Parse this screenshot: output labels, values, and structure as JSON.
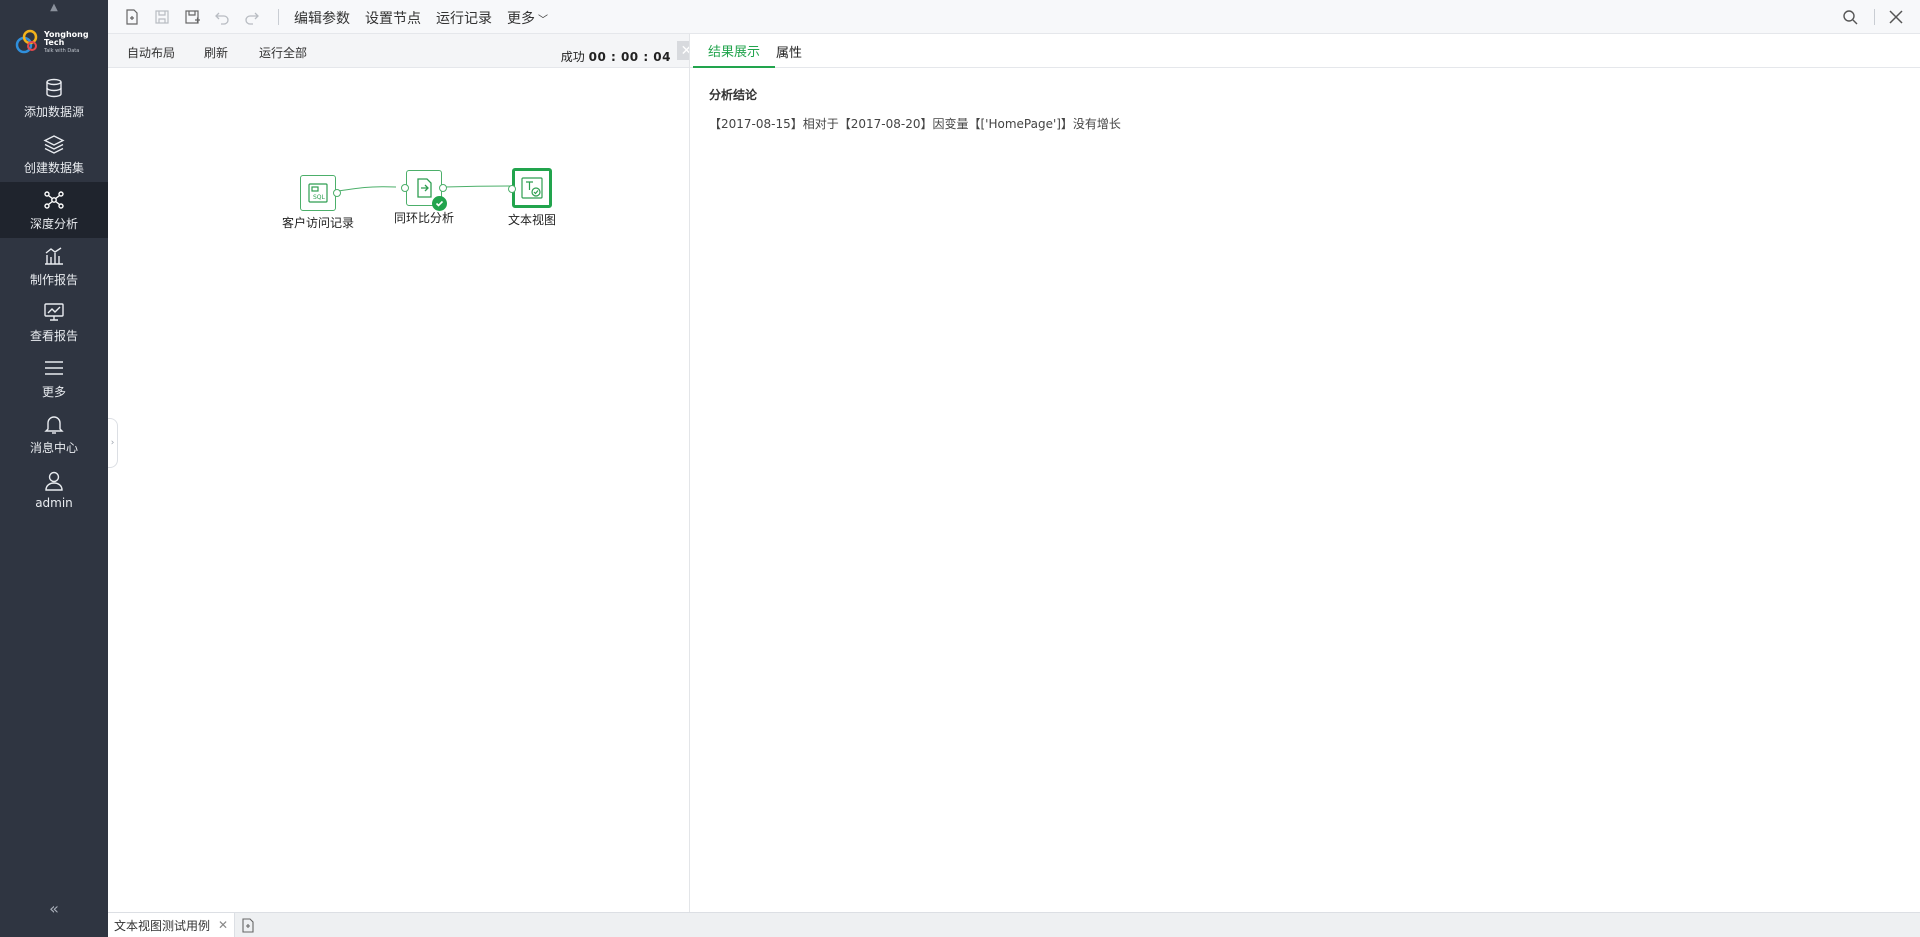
{
  "sidebar": {
    "logo": {
      "line1": "Yonghong Tech",
      "line2": "Talk with Data"
    },
    "items": [
      {
        "label": "添加数据源",
        "icon": "database-icon"
      },
      {
        "label": "创建数据集",
        "icon": "layers-icon"
      },
      {
        "label": "深度分析",
        "icon": "network-icon",
        "active": true
      },
      {
        "label": "制作报告",
        "icon": "bar-chart-icon"
      },
      {
        "label": "查看报告",
        "icon": "monitor-chart-icon"
      },
      {
        "label": "更多",
        "icon": "menu-icon"
      },
      {
        "label": "消息中心",
        "icon": "bell-icon"
      },
      {
        "label": "admin",
        "icon": "user-icon"
      }
    ],
    "collapse_glyph": "«"
  },
  "toolbar": {
    "menu": [
      "编辑参数",
      "设置节点",
      "运行记录",
      "更多"
    ]
  },
  "left_panel": {
    "buttons": [
      "自动布局",
      "刷新",
      "运行全部"
    ],
    "status_label": "成功",
    "status_time": "00 : 00 : 04"
  },
  "flow": {
    "nodes": [
      {
        "label": "客户访问记录",
        "type": "sql"
      },
      {
        "label": "同环比分析",
        "type": "analysis",
        "status": "success"
      },
      {
        "label": "文本视图",
        "type": "text-view",
        "selected": true
      }
    ]
  },
  "right_panel": {
    "tabs": [
      "结果展示",
      "属性"
    ],
    "active_tab": "结果展示",
    "result_title": "分析结论",
    "result_text": "【2017-08-15】相对于【2017-08-20】因变量【['HomePage']】没有增长"
  },
  "bottom": {
    "doc_tab": "文本视图测试用例"
  },
  "colors": {
    "sidebar_bg": "#2f3541",
    "accent": "#22a44d"
  }
}
